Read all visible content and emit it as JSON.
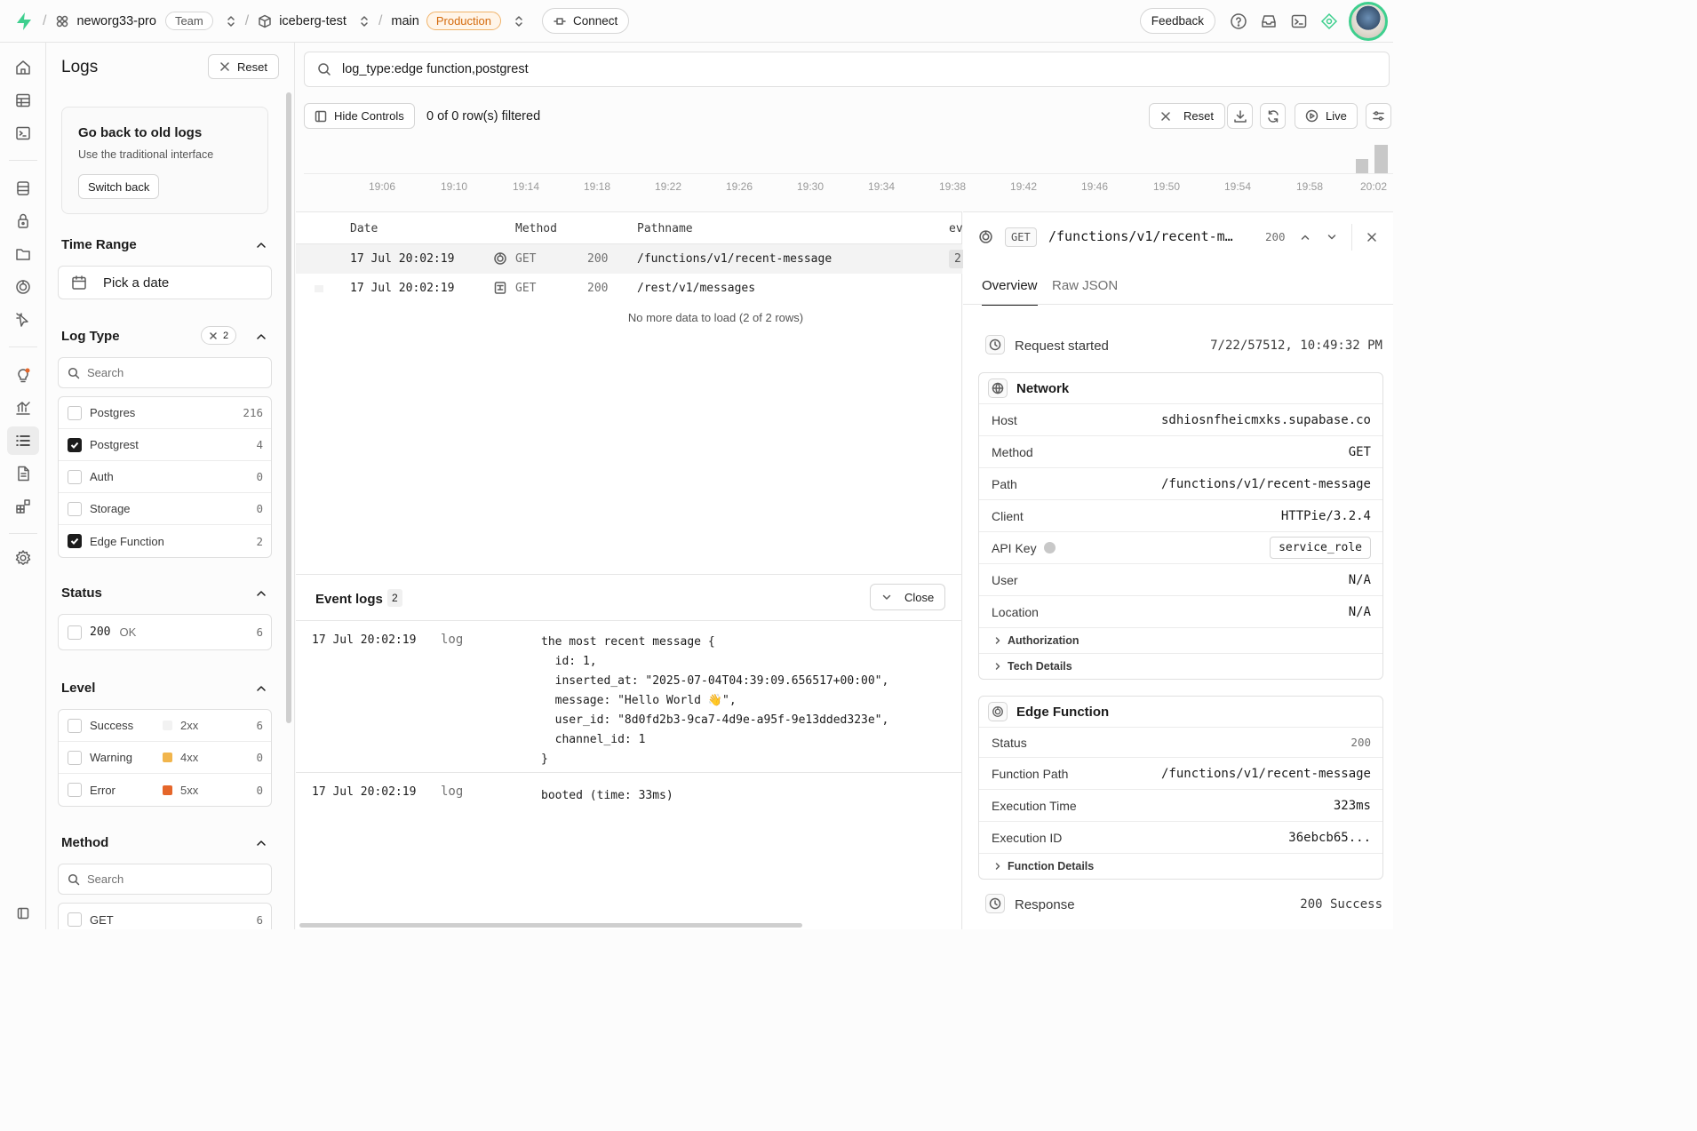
{
  "topbar": {
    "org": "neworg33-pro",
    "org_badge": "Team",
    "project": "iceberg-test",
    "branch": "main",
    "env": "Production",
    "connect": "Connect",
    "feedback": "Feedback"
  },
  "sidebar": {
    "title": "Logs",
    "reset": "Reset",
    "oldlogs": {
      "title": "Go back to old logs",
      "desc": "Use the traditional interface",
      "button": "Switch back"
    },
    "time_range": {
      "title": "Time Range",
      "placeholder": "Pick a date"
    },
    "log_type": {
      "title": "Log Type",
      "selected_count": "2",
      "search": "Search",
      "items": [
        {
          "label": "Postgres",
          "count": "216",
          "checked": false
        },
        {
          "label": "Postgrest",
          "count": "4",
          "checked": true
        },
        {
          "label": "Auth",
          "count": "0",
          "checked": false
        },
        {
          "label": "Storage",
          "count": "0",
          "checked": false
        },
        {
          "label": "Edge Function",
          "count": "2",
          "checked": true
        }
      ]
    },
    "status": {
      "title": "Status",
      "items": [
        {
          "code": "200",
          "text": "OK",
          "count": "6"
        }
      ]
    },
    "level": {
      "title": "Level",
      "items": [
        {
          "label": "Success",
          "code": "2xx",
          "count": "6",
          "color": "#f2f2f2"
        },
        {
          "label": "Warning",
          "code": "4xx",
          "count": "0",
          "color": "#f1b54c"
        },
        {
          "label": "Error",
          "code": "5xx",
          "count": "0",
          "color": "#e5662a"
        }
      ]
    },
    "method": {
      "title": "Method",
      "search": "Search",
      "items": [
        {
          "label": "GET",
          "count": "6"
        }
      ]
    }
  },
  "main": {
    "query": "log_type:edge function,postgrest",
    "hide_controls": "Hide Controls",
    "rows_filtered": "0 of 0 row(s) filtered",
    "reset": "Reset",
    "live": "Live",
    "timeline_ticks": [
      "19:06",
      "19:10",
      "19:14",
      "19:18",
      "19:22",
      "19:26",
      "19:30",
      "19:34",
      "19:38",
      "19:42",
      "19:46",
      "19:50",
      "19:54",
      "19:58",
      "20:02"
    ],
    "table": {
      "headers": {
        "date": "Date",
        "method": "Method",
        "pathname": "Pathname",
        "ev": "ev"
      },
      "rows": [
        {
          "date": "17 Jul 20:02:19",
          "method": "GET",
          "status": "200",
          "path": "/functions/v1/recent-message",
          "ev": "2"
        },
        {
          "date": "17 Jul 20:02:19",
          "method": "GET",
          "status": "200",
          "path": "/rest/v1/messages",
          "ev": ""
        }
      ],
      "footer": "No more data to load (2 of 2 rows)"
    },
    "events": {
      "title": "Event logs",
      "count": "2",
      "close": "Close",
      "items": [
        {
          "date": "17 Jul 20:02:19",
          "level": "log",
          "msg": "the most recent message {\n  id: 1,\n  inserted_at: \"2025-07-04T04:39:09.656517+00:00\",\n  message: \"Hello World 👋\",\n  user_id: \"8d0fd2b3-9ca7-4d9e-a95f-9e13dded323e\",\n  channel_id: 1\n}"
        },
        {
          "date": "17 Jul 20:02:19",
          "level": "log",
          "msg": "booted (time: 33ms)"
        }
      ]
    }
  },
  "detail": {
    "method": "GET",
    "path": "/functions/v1/recent-m…",
    "status": "200",
    "tabs": [
      "Overview",
      "Raw JSON"
    ],
    "request_started": {
      "label": "Request started",
      "value": "7/22/57512, 10:49:32 PM"
    },
    "network": {
      "title": "Network",
      "host": {
        "label": "Host",
        "value": "sdhiosnfheicmxks.supabase.co"
      },
      "method": {
        "label": "Method",
        "value": "GET"
      },
      "path": {
        "label": "Path",
        "value": "/functions/v1/recent-message"
      },
      "client": {
        "label": "Client",
        "value": "HTTPie/3.2.4"
      },
      "apikey": {
        "label": "API Key",
        "value": "service_role"
      },
      "user": {
        "label": "User",
        "value": "N/A"
      },
      "location": {
        "label": "Location",
        "value": "N/A"
      },
      "auth": "Authorization",
      "tech": "Tech Details"
    },
    "edge": {
      "title": "Edge Function",
      "status": {
        "label": "Status",
        "value": "200"
      },
      "fpath": {
        "label": "Function Path",
        "value": "/functions/v1/recent-message"
      },
      "exec_time": {
        "label": "Execution Time",
        "value": "323ms"
      },
      "exec_id": {
        "label": "Execution ID",
        "value": "36ebcb65..."
      },
      "details": "Function Details"
    },
    "response": {
      "label": "Response",
      "value": "200 Success"
    }
  }
}
